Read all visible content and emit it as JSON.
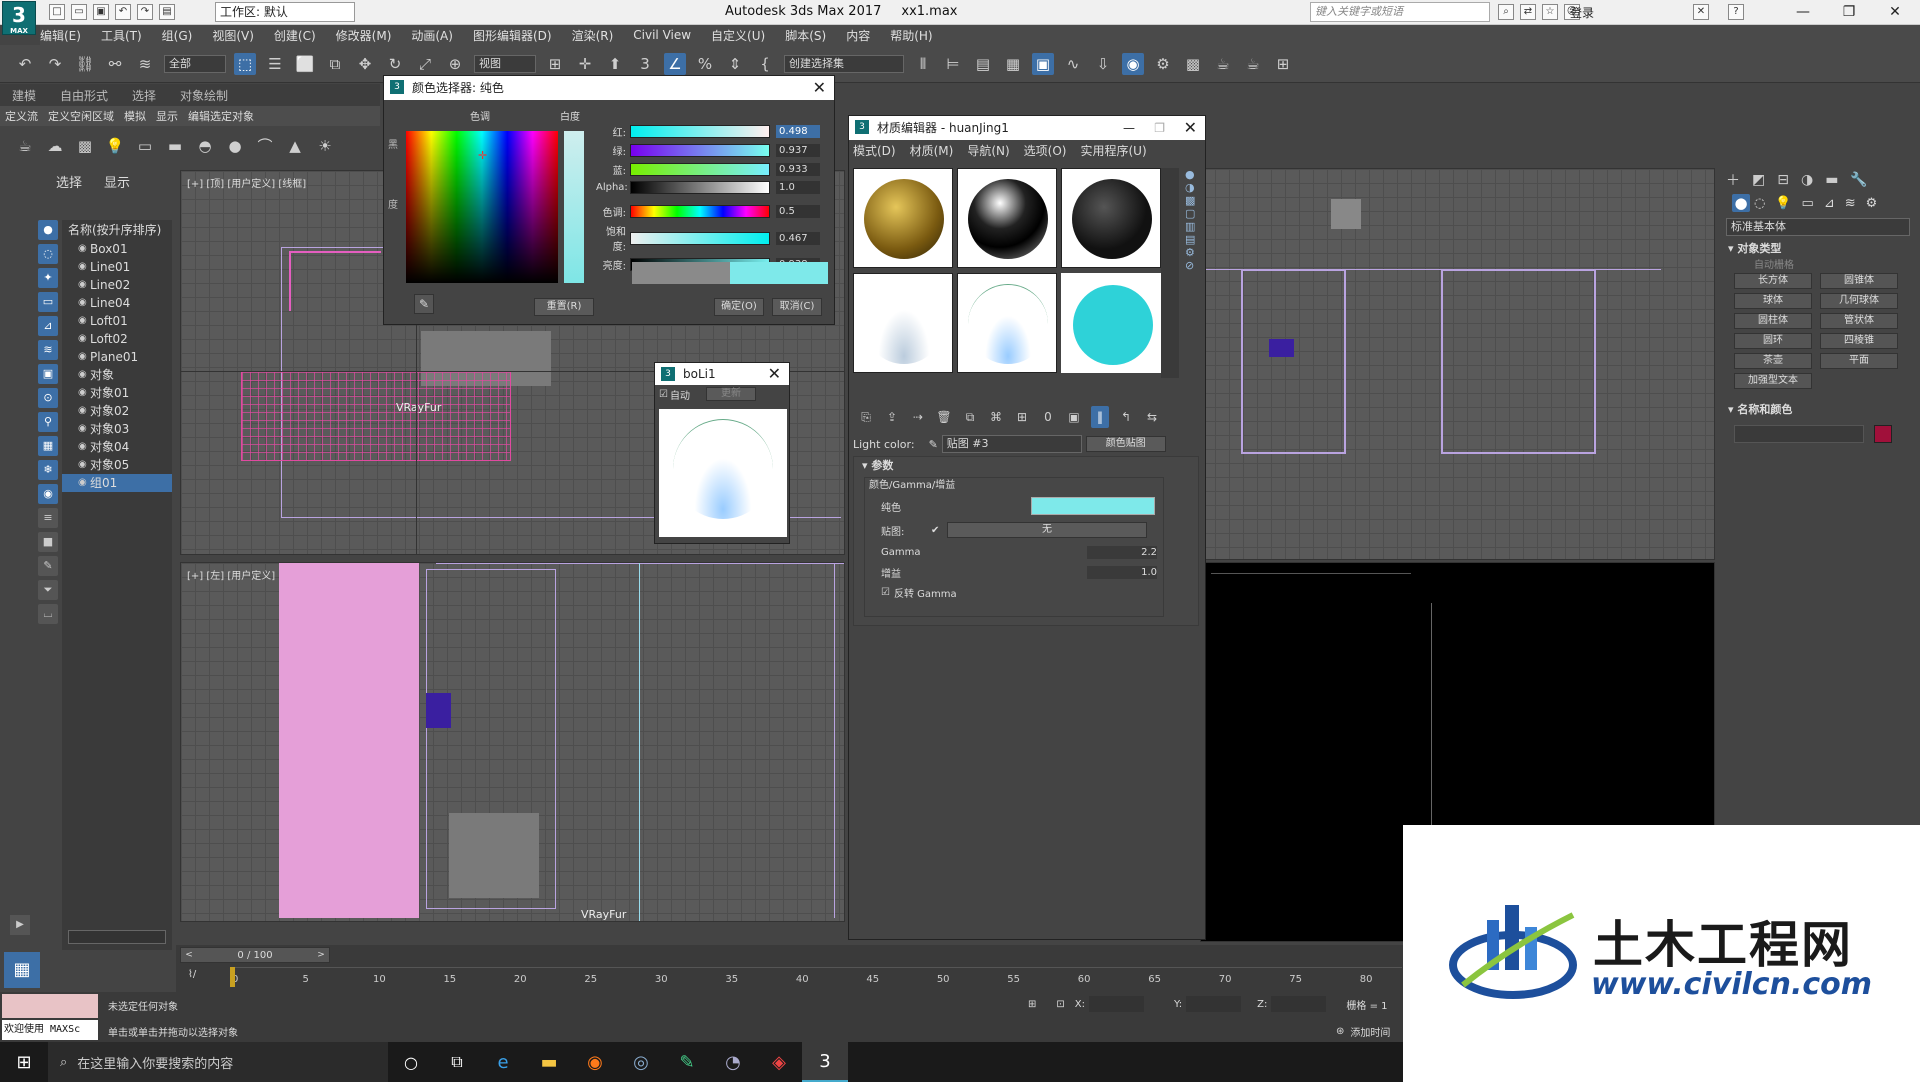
{
  "app": {
    "title": "Autodesk 3ds Max 2017",
    "file": "xx1.max",
    "workspace": "工作区: 默认",
    "search_placeholder": "键入关键字或短语",
    "login": "登录"
  },
  "menu": [
    "编辑(E)",
    "工具(T)",
    "组(G)",
    "视图(V)",
    "创建(C)",
    "修改器(M)",
    "动画(A)",
    "图形编辑器(D)",
    "渲染(R)",
    "Civil View",
    "自定义(U)",
    "脚本(S)",
    "内容",
    "帮助(H)"
  ],
  "toolbar": {
    "filter": "全部",
    "view": "视图",
    "selection_set": "创建选择集"
  },
  "ribbon": {
    "tabs": [
      "建模",
      "自由形式",
      "选择",
      "对象绘制"
    ],
    "sub": [
      "定义流",
      "定义空闲区域",
      "模拟",
      "显示",
      "编辑选定对象"
    ]
  },
  "scene": {
    "tabs": [
      "选择",
      "显示"
    ],
    "header": "名称(按升序排序)",
    "items": [
      "Box01",
      "Line01",
      "Line02",
      "Line04",
      "Loft01",
      "Loft02",
      "Plane01",
      "对象",
      "对象01",
      "对象02",
      "对象03",
      "对象04",
      "对象05",
      "组01"
    ]
  },
  "viewports": {
    "top_left": "[+] [顶] [用户定义] [线框]",
    "bottom_left": "[+] [左] [用户定义] [线框]",
    "label_vrayfur": "VRayFur"
  },
  "color_dialog": {
    "title": "颜色选择器: 纯色",
    "hue_label": "色调",
    "white_label": "白度",
    "side_labels": [
      "黑",
      "度"
    ],
    "sliders": [
      {
        "label": "红:",
        "value": "0.498"
      },
      {
        "label": "绿:",
        "value": "0.937"
      },
      {
        "label": "蓝:",
        "value": "0.933"
      },
      {
        "label": "Alpha:",
        "value": "1.0"
      },
      {
        "label": "色调:",
        "value": "0.5"
      },
      {
        "label": "饱和度:",
        "value": "0.467"
      },
      {
        "label": "亮度:",
        "value": "0.938"
      }
    ],
    "reset": "重置(R)",
    "ok": "确定(O)",
    "cancel": "取消(C)",
    "accent": "#7ee9ea"
  },
  "boli": {
    "title": "boLi1",
    "auto": "自动",
    "update": "更新"
  },
  "material_editor": {
    "title": "材质编辑器 - huanJing1",
    "menu": [
      "模式(D)",
      "材质(M)",
      "导航(N)",
      "选项(O)",
      "实用程序(U)"
    ],
    "light_color_label": "Light color:",
    "map_name": "贴图 #3",
    "map_type": "颜色贴图",
    "params": "参数",
    "group_title": "颜色/Gamma/增益",
    "solid_color": "纯色",
    "map_label": "贴图:",
    "map_none": "无",
    "gamma_label": "Gamma",
    "gamma_value": "2.2",
    "gain_label": "增益",
    "gain_value": "1.0",
    "invert_gamma": "反转 Gamma"
  },
  "command_panel": {
    "dropdown": "标准基本体",
    "object_type": "对象类型",
    "auto_grid": "自动栅格",
    "buttons": [
      "长方体",
      "圆锥体",
      "球体",
      "几何球体",
      "圆柱体",
      "管状体",
      "圆环",
      "四棱锥",
      "茶壶",
      "平面",
      "加强型文本"
    ],
    "name_color": "名称和颜色",
    "swatch": "#a0103a"
  },
  "timeline": {
    "frame": "0 / 100",
    "ticks": [
      "0",
      "5",
      "10",
      "15",
      "20",
      "25",
      "30",
      "35",
      "40",
      "45",
      "50",
      "55",
      "60",
      "65",
      "70",
      "75",
      "80"
    ]
  },
  "status": {
    "welcome": "欢迎使用 MAXSc",
    "line1": "未选定任何对象",
    "line2": "单击或单击并拖动以选择对象",
    "x": "X:",
    "y": "Y:",
    "z": "Z:",
    "grid": "栅格 = 1",
    "add_time": "添加时间"
  },
  "taskbar": {
    "search": "在这里输入你要搜索的内容"
  },
  "watermark": {
    "cn": "土木工程网",
    "url": "www.civilcn.com"
  }
}
